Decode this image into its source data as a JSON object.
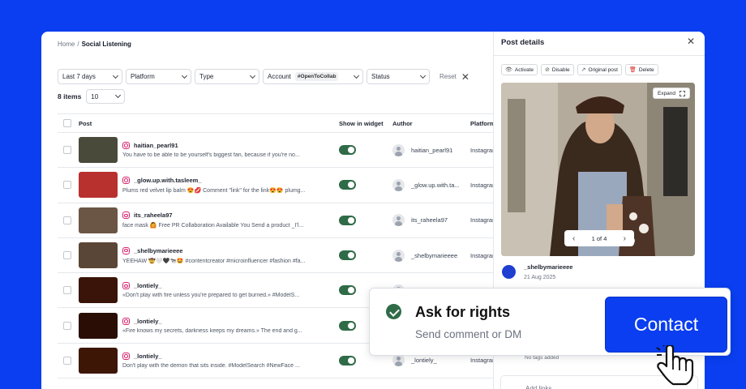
{
  "breadcrumb": {
    "home": "Home",
    "separator": "/",
    "current": "Social Listening"
  },
  "filters": {
    "date": "Last 7 days",
    "platform": "Platform",
    "type": "Type",
    "account_label": "Account",
    "account_tag": "#OpenToCollab",
    "status": "Status",
    "reset": "Reset"
  },
  "items": {
    "count_label": "8 items",
    "per_page": "10"
  },
  "table": {
    "headers": {
      "post": "Post",
      "widget": "Show in widget",
      "author": "Author",
      "platform": "Platform"
    },
    "rows": [
      {
        "username": "haitian_pearl91",
        "caption": "You have to be able to be yourself's biggest fan, because if you're no...",
        "author": "haitian_pearl91",
        "platform": "Instagram",
        "thumb": "#4a4a3a"
      },
      {
        "username": "_glow.up.with.tasleem_",
        "caption": "Plums red velvet lip balm 😍💋 Comment \"link\" for the link😍😍 plumg...",
        "author": "_glow.up.with.ta...",
        "platform": "Instagram",
        "thumb": "#b8312f"
      },
      {
        "username": "its_raheela97",
        "caption": "face mask 🙆 Free PR Collaboration Available You Send a product _I'l...",
        "author": "its_raheela97",
        "platform": "Instagram",
        "thumb": "#6b5544"
      },
      {
        "username": "_shelbymarieeee",
        "caption": "YEEHAW 🤠🤍🖤🐄🤩 #contentcreator #microinfluencer #fashion #fa...",
        "author": "_shelbymarieeee",
        "platform": "Instagram",
        "thumb": "#5a4636"
      },
      {
        "username": "_lontiely_",
        "caption": "«Don't play with fire unless you're prepared to get burned.» #ModelS...",
        "author": "_lontiely_",
        "platform": "Instagram",
        "thumb": "#3a1408"
      },
      {
        "username": "_lontiely_",
        "caption": "«Fire knows my secrets, darkness keeps my dreams.» The end and g...",
        "author": "_lontiely_",
        "platform": "Instagram",
        "thumb": "#2a0e06"
      },
      {
        "username": "_lontiely_",
        "caption": "Don't play with the demon that sits inside. #ModelSearch #NewFace ...",
        "author": "_lontiely_",
        "platform": "Instagram",
        "thumb": "#3d1606"
      }
    ]
  },
  "panel": {
    "title": "Post details",
    "actions": [
      {
        "icon": "eye-icon",
        "glyph": "👁",
        "label": "Activate"
      },
      {
        "icon": "eye-off-icon",
        "glyph": "⊘",
        "label": "Disable"
      },
      {
        "icon": "external-link-icon",
        "glyph": "↗",
        "label": "Original post"
      },
      {
        "icon": "trash-icon",
        "glyph": "🗑",
        "label": "Delete"
      }
    ],
    "expand": "Expand",
    "pager": "1 of 4",
    "author": "_shelbymarieeee",
    "date": "21 Aug 2025",
    "tags_note": "No tags added",
    "links": "Add links"
  },
  "rights": {
    "title": "Ask for rights",
    "subtitle": "Send comment or DM"
  },
  "contact": "Contact",
  "colors": {
    "background": "#0a3ef0",
    "toggle_on": "#2f6b47",
    "check": "#2f6b47",
    "delete": "#dc2626"
  }
}
